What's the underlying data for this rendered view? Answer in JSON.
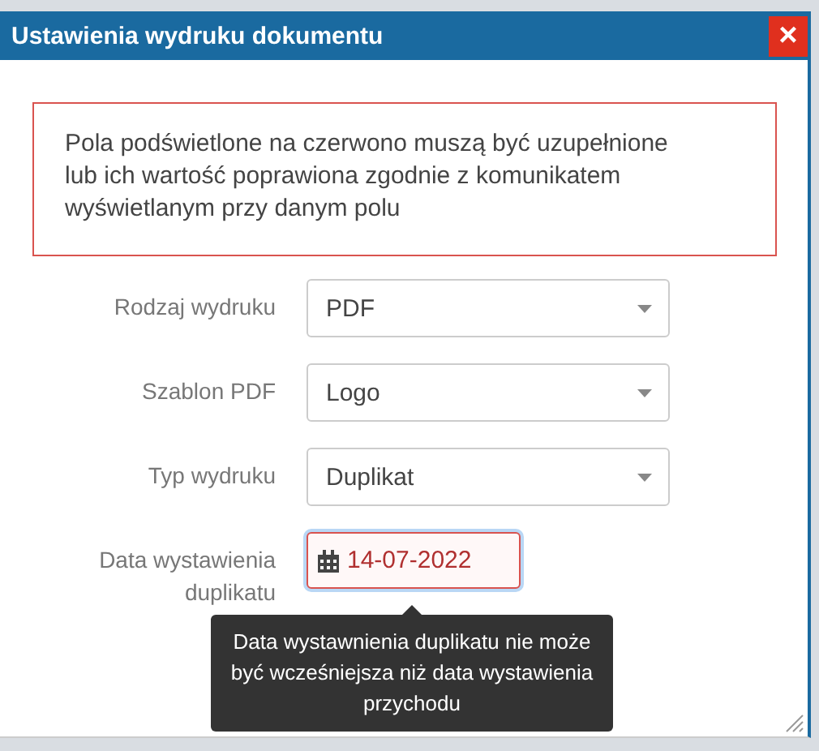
{
  "dialog": {
    "title": "Ustawienia wydruku dokumentu",
    "close_label": "×"
  },
  "alert": {
    "text": "Pola podświetlone na czerwono muszą być uzupełnione lub ich wartość poprawiona zgodnie z komunikatem wyświetlanym przy danym polu"
  },
  "fields": [
    {
      "kind": "select",
      "label": "Rodzaj wydruku",
      "value": "PDF",
      "invalid": false
    },
    {
      "kind": "select",
      "label": "Szablon PDF",
      "value": "Logo",
      "invalid": false
    },
    {
      "kind": "select",
      "label": "Typ wydruku",
      "value": "Duplikat",
      "invalid": false
    },
    {
      "kind": "date",
      "label": "Data wystawienia duplikatu",
      "value": "14-07-2022",
      "invalid": true,
      "focused": true
    }
  ],
  "tooltip": {
    "text": "Data wystawnienia duplikatu nie może być wcześniejsza niż data wystawienia przychodu"
  }
}
